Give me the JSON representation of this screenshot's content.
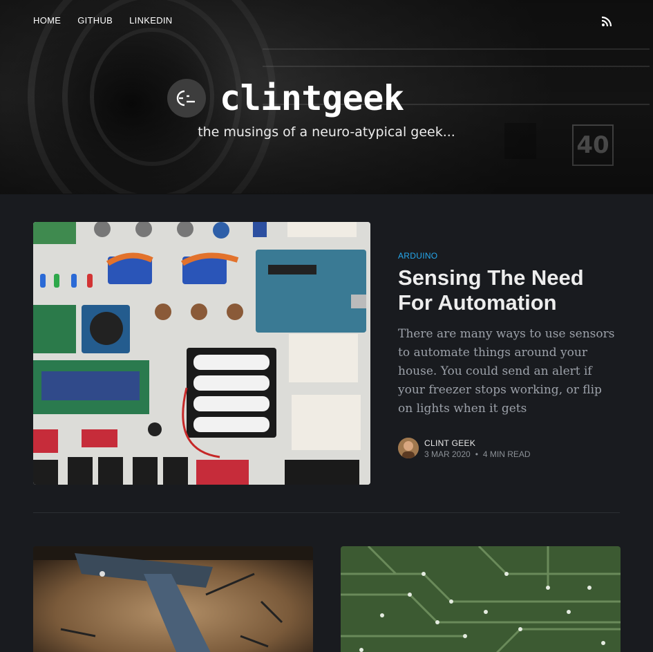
{
  "nav": {
    "items": [
      "HOME",
      "GITHUB",
      "LINKEDIN"
    ]
  },
  "header": {
    "site_name": "clintgeek",
    "tagline": "the musings of a neuro-atypical geek...",
    "sign_text": "40",
    "rss_icon": "rss-icon",
    "logo_icon": "logo-face-icon"
  },
  "featured_post": {
    "tag": "ARDUINO",
    "title": "Sensing The Need For Automation",
    "excerpt": "There are many ways to use sensors to automate things around your house. You could send an alert if your freezer stops working, or flip on lights when it gets",
    "author": "CLINT GEEK",
    "date": "3 MAR 2020",
    "separator": "•",
    "read_time": "4 MIN READ"
  },
  "colors": {
    "background": "#191b1f",
    "accent": "#26a8ed",
    "excerpt": "#9ca1a9"
  }
}
